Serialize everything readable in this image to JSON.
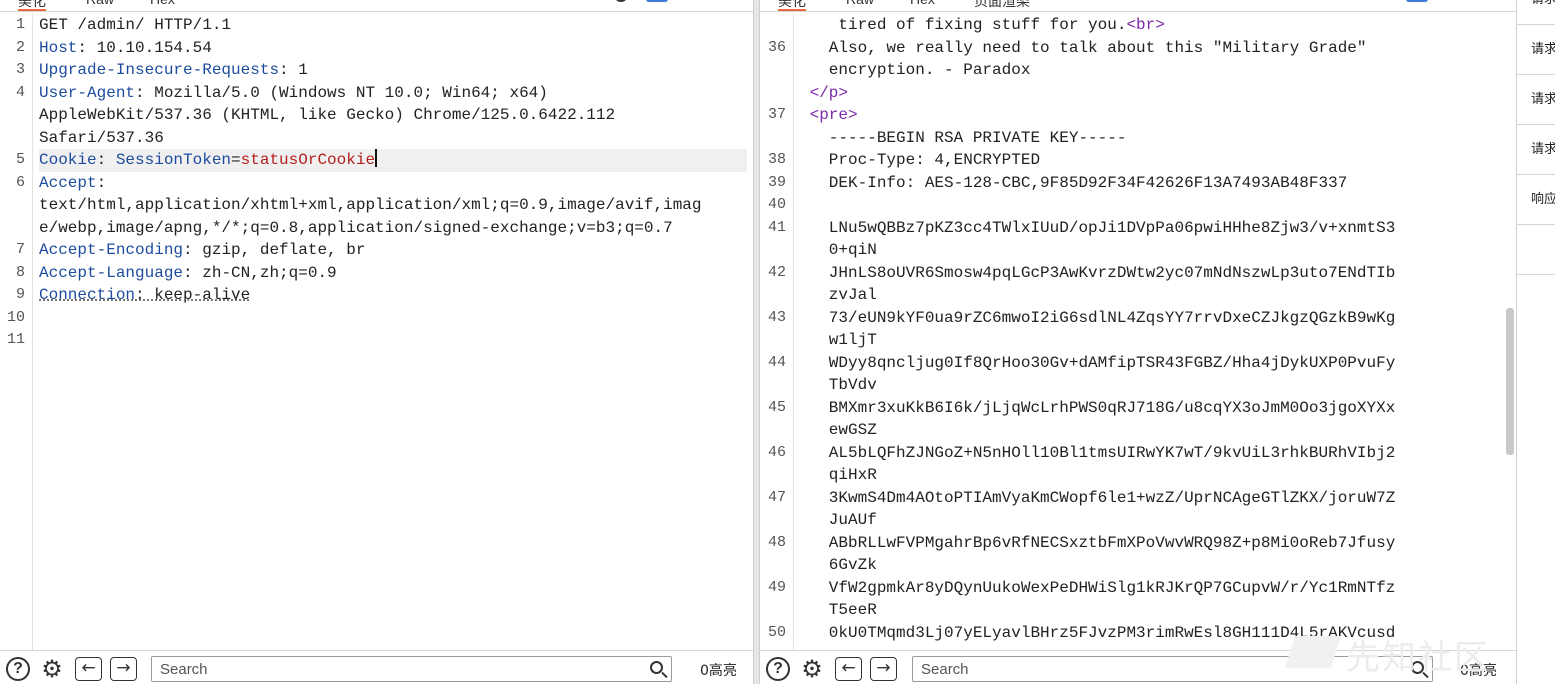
{
  "request_pane": {
    "tabs": [
      "美化",
      "Raw",
      "Hex"
    ],
    "lines": [
      {
        "n": "1",
        "parts": [
          {
            "t": "GET /admin/ HTTP/1.1",
            "c": "v"
          }
        ]
      },
      {
        "n": "2",
        "parts": [
          {
            "t": "Host",
            "c": "k"
          },
          {
            "t": ": 10.10.154.54",
            "c": "v"
          }
        ]
      },
      {
        "n": "3",
        "parts": [
          {
            "t": "Upgrade-Insecure-Requests",
            "c": "k"
          },
          {
            "t": ": 1",
            "c": "v"
          }
        ]
      },
      {
        "n": "4",
        "parts": [
          {
            "t": "User-Agent",
            "c": "k"
          },
          {
            "t": ": Mozilla/5.0 (Windows NT 10.0; Win64; x64)",
            "c": "v"
          }
        ]
      },
      {
        "n": "",
        "parts": [
          {
            "t": "AppleWebKit/537.36 (KHTML, like Gecko) Chrome/125.0.6422.112",
            "c": "v"
          }
        ]
      },
      {
        "n": "",
        "parts": [
          {
            "t": "Safari/537.36",
            "c": "v"
          }
        ]
      },
      {
        "n": "5",
        "highlight": true,
        "parts": [
          {
            "t": "Cookie",
            "c": "k"
          },
          {
            "t": ": ",
            "c": "v"
          },
          {
            "t": "SessionToken",
            "c": "k"
          },
          {
            "t": "=",
            "c": "v"
          },
          {
            "t": "statusOrCookie",
            "c": "cv"
          }
        ],
        "caret": true
      },
      {
        "n": "6",
        "parts": [
          {
            "t": "Accept",
            "c": "k"
          },
          {
            "t": ":",
            "c": "v"
          }
        ]
      },
      {
        "n": "",
        "parts": [
          {
            "t": "text/html,application/xhtml+xml,application/xml;q=0.9,image/avif,imag",
            "c": "v"
          }
        ]
      },
      {
        "n": "",
        "parts": [
          {
            "t": "e/webp,image/apng,*/*;q=0.8,application/signed-exchange;v=b3;q=0.7",
            "c": "v"
          }
        ]
      },
      {
        "n": "7",
        "parts": [
          {
            "t": "Accept-Encoding",
            "c": "k"
          },
          {
            "t": ": gzip, deflate, br",
            "c": "v"
          }
        ]
      },
      {
        "n": "8",
        "parts": [
          {
            "t": "Accept-Language",
            "c": "k"
          },
          {
            "t": ": zh-CN,zh;q=0.9",
            "c": "v"
          }
        ]
      },
      {
        "n": "9",
        "parts": [
          {
            "t": "Connection",
            "c": "k uline"
          },
          {
            "t": ": keep-alive",
            "c": "v uline"
          }
        ]
      },
      {
        "n": "10",
        "parts": []
      },
      {
        "n": "11",
        "parts": []
      }
    ],
    "search_placeholder": "Search",
    "highlight_count": "0高亮"
  },
  "response_pane": {
    "tabs": [
      "美化",
      "Raw",
      "Hex",
      "页面渲染"
    ],
    "lines": [
      {
        "n": "",
        "parts": [
          {
            "t": "    tired of fixing stuff for you.",
            "c": "v"
          },
          {
            "t": "<br>",
            "c": "tag"
          }
        ]
      },
      {
        "n": "36",
        "parts": [
          {
            "t": "   Also, we really need to talk about this \"Military Grade\"",
            "c": "v"
          }
        ]
      },
      {
        "n": "",
        "parts": [
          {
            "t": "   encryption. - Paradox",
            "c": "v"
          }
        ]
      },
      {
        "n": "",
        "parts": [
          {
            "t": " </p>",
            "c": "tag"
          }
        ]
      },
      {
        "n": "37",
        "parts": [
          {
            "t": " <pre>",
            "c": "tag"
          }
        ]
      },
      {
        "n": "",
        "parts": [
          {
            "t": "   -----BEGIN RSA PRIVATE KEY-----",
            "c": "v"
          }
        ]
      },
      {
        "n": "38",
        "parts": [
          {
            "t": "   Proc-Type: 4,ENCRYPTED",
            "c": "v"
          }
        ]
      },
      {
        "n": "39",
        "parts": [
          {
            "t": "   DEK-Info: AES-128-CBC,9F85D92F34F42626F13A7493AB48F337",
            "c": "v"
          }
        ]
      },
      {
        "n": "40",
        "parts": []
      },
      {
        "n": "41",
        "parts": [
          {
            "t": "   LNu5wQBBz7pKZ3cc4TWlxIUuD/opJi1DVpPa06pwiHHhe8Zjw3/v+xnmtS3",
            "c": "v"
          }
        ]
      },
      {
        "n": "",
        "parts": [
          {
            "t": "   0+qiN",
            "c": "v"
          }
        ]
      },
      {
        "n": "42",
        "parts": [
          {
            "t": "   JHnLS8oUVR6Smosw4pqLGcP3AwKvrzDWtw2yc07mNdNszwLp3uto7ENdTIb",
            "c": "v"
          }
        ]
      },
      {
        "n": "",
        "parts": [
          {
            "t": "   zvJal",
            "c": "v"
          }
        ]
      },
      {
        "n": "43",
        "parts": [
          {
            "t": "   73/eUN9kYF0ua9rZC6mwoI2iG6sdlNL4ZqsYY7rrvDxeCZJkgzQGzkB9wKg",
            "c": "v"
          }
        ]
      },
      {
        "n": "",
        "parts": [
          {
            "t": "   w1ljT",
            "c": "v"
          }
        ]
      },
      {
        "n": "44",
        "parts": [
          {
            "t": "   WDyy8qncljug0If8QrHoo30Gv+dAMfipTSR43FGBZ/Hha4jDykUXP0PvuFy",
            "c": "v"
          }
        ]
      },
      {
        "n": "",
        "parts": [
          {
            "t": "   TbVdv",
            "c": "v"
          }
        ]
      },
      {
        "n": "45",
        "parts": [
          {
            "t": "   BMXmr3xuKkB6I6k/jLjqWcLrhPWS0qRJ718G/u8cqYX3oJmM0Oo3jgoXYXx",
            "c": "v"
          }
        ]
      },
      {
        "n": "",
        "parts": [
          {
            "t": "   ewGSZ",
            "c": "v"
          }
        ]
      },
      {
        "n": "46",
        "parts": [
          {
            "t": "   AL5bLQFhZJNGoZ+N5nHOll10Bl1tmsUIRwYK7wT/9kvUiL3rhkBURhVIbj2",
            "c": "v"
          }
        ]
      },
      {
        "n": "",
        "parts": [
          {
            "t": "   qiHxR",
            "c": "v"
          }
        ]
      },
      {
        "n": "47",
        "parts": [
          {
            "t": "   3KwmS4Dm4AOtoPTIAmVyaKmCWopf6le1+wzZ/UprNCAgeGTlZKX/joruW7Z",
            "c": "v"
          }
        ]
      },
      {
        "n": "",
        "parts": [
          {
            "t": "   JuAUf",
            "c": "v"
          }
        ]
      },
      {
        "n": "48",
        "parts": [
          {
            "t": "   ABbRLLwFVPMgahrBp6vRfNECSxztbFmXPoVwvWRQ98Z+p8Mi0oReb7Jfusy",
            "c": "v"
          }
        ]
      },
      {
        "n": "",
        "parts": [
          {
            "t": "   6GvZk",
            "c": "v"
          }
        ]
      },
      {
        "n": "49",
        "parts": [
          {
            "t": "   VfW2gpmkAr8yDQynUukoWexPeDHWiSlg1kRJKrQP7GCupvW/r/Yc1RmNTfz",
            "c": "v"
          }
        ]
      },
      {
        "n": "",
        "parts": [
          {
            "t": "   T5eeR",
            "c": "v"
          }
        ]
      },
      {
        "n": "50",
        "parts": [
          {
            "t": "   0kU0TMqmd3Lj07yELyavlBHrz5FJvzPM3rimRwEsl8GH111D4L5rAKVcusd",
            "c": "v"
          }
        ]
      }
    ],
    "search_placeholder": "Search",
    "highlight_count": "0高亮"
  },
  "sidebar": {
    "items": [
      "请求",
      "请求",
      "请求",
      "请求",
      "响应"
    ]
  },
  "watermark": "先知社区",
  "icons": {
    "help": "help-icon",
    "settings": "gear-icon",
    "back": "arrow-left-icon",
    "forward": "arrow-right-icon",
    "search": "search-icon"
  },
  "colors": {
    "header_key": "#1d4c9e",
    "cookie_value": "#b22020",
    "html_tag": "#7a2aa8",
    "active_tab_underline": "#e8673c",
    "button_accent": "#3d7bd6"
  }
}
